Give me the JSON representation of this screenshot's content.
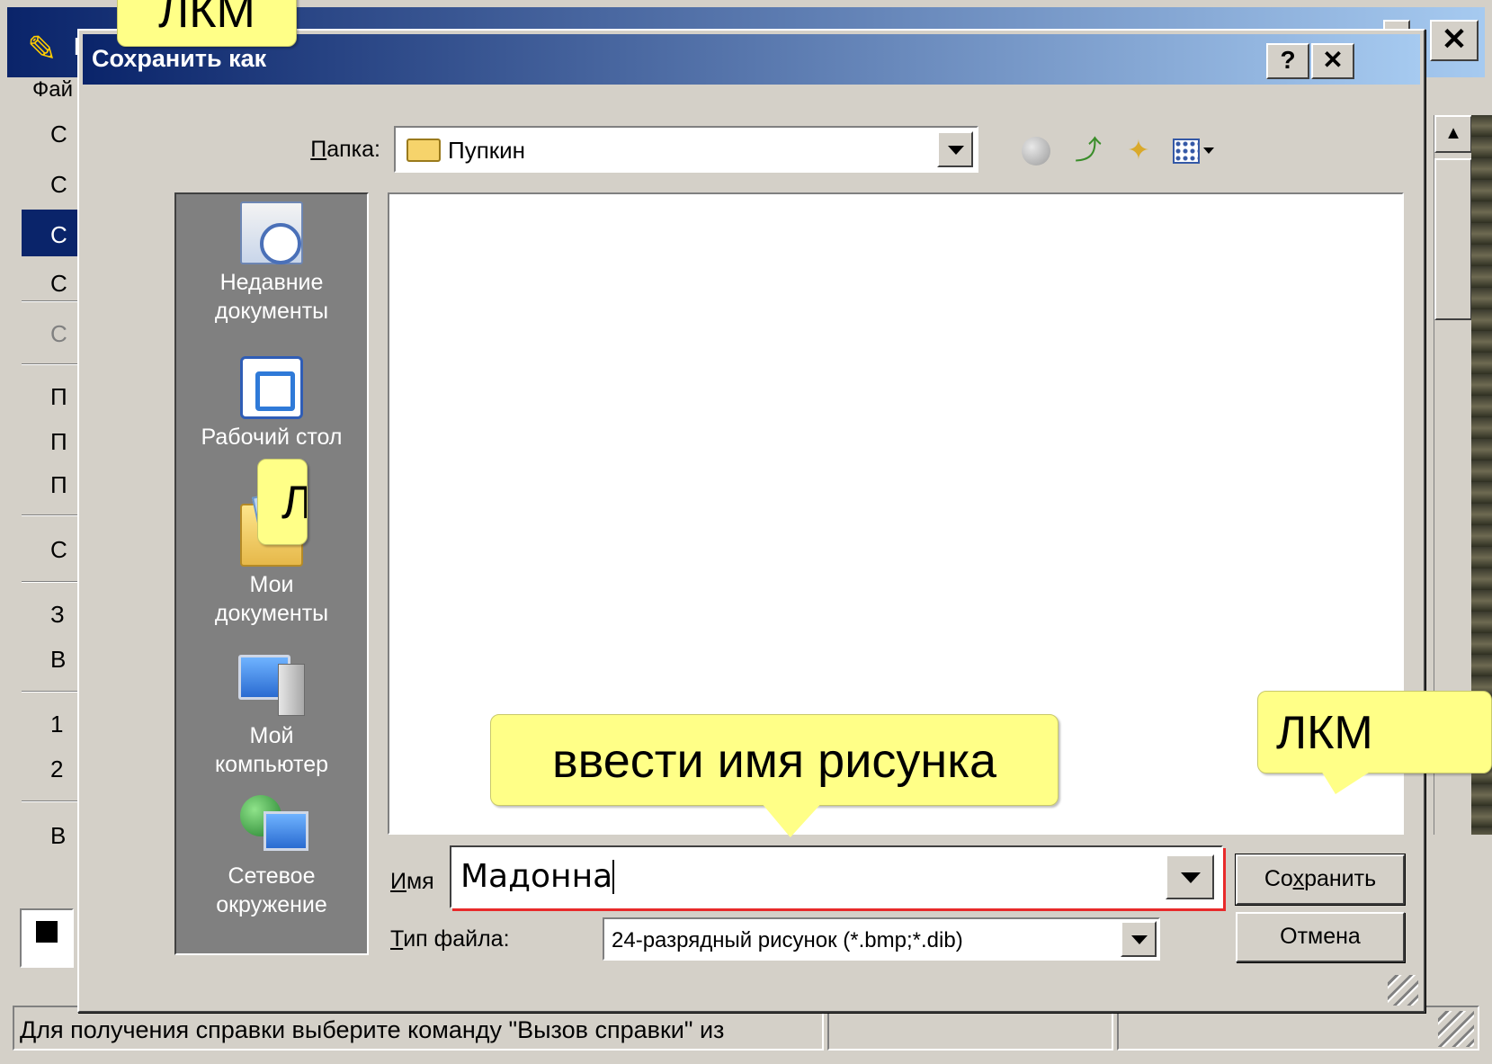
{
  "background_window": {
    "title_first_letter": "Б",
    "menu_first_item": "Фай",
    "menu_initials": [
      "С",
      "С",
      "С",
      "С",
      "С",
      "П",
      "П",
      "П",
      "С",
      "З",
      "В",
      "1",
      "2",
      "В"
    ],
    "status_text": "Для получения справки выберите команду \"Вызов справки\" из",
    "caption_close": "✕",
    "scroll_up_glyph": "▲"
  },
  "dialog": {
    "title": "Сохранить как",
    "help_button": "?",
    "close_button": "✕",
    "folder_label": "Папка:",
    "folder_label_accel": "П",
    "folder_value": "Пупкин",
    "toolbar": {
      "back_icon": "back-icon",
      "up_icon": "up-folder-icon",
      "new_folder_icon": "new-folder-icon",
      "views_icon": "views-menu-icon"
    },
    "places": [
      {
        "label": "Недавние документы",
        "icon": "recent-documents-icon"
      },
      {
        "label": "Рабочий стол",
        "icon": "desktop-icon"
      },
      {
        "label": "Мои документы",
        "icon": "my-documents-icon"
      },
      {
        "label": "Мой компьютер",
        "icon": "my-computer-icon"
      },
      {
        "label": "Сетевое окружение",
        "icon": "network-icon"
      }
    ],
    "filename_label": "Имя",
    "filename_label_accel": "И",
    "filename_value": "Мадонна",
    "filetype_label": "Тип файла:",
    "filetype_label_accel": "Т",
    "filetype_value": "24-разрядный рисунок (*.bmp;*.dib)",
    "save_button": "Сохранить",
    "save_button_accel": "х",
    "cancel_button": "Отмена"
  },
  "callouts": {
    "top": "ЛКМ",
    "left": "Л",
    "right": "ЛКМ",
    "main": "ввести имя рисунка"
  },
  "colors": {
    "titlebar_start": "#0a246a",
    "titlebar_end": "#a6caf0",
    "callout_fill": "#ffff87",
    "highlight_red": "#e82a2a",
    "window_face": "#d4d0c8"
  }
}
